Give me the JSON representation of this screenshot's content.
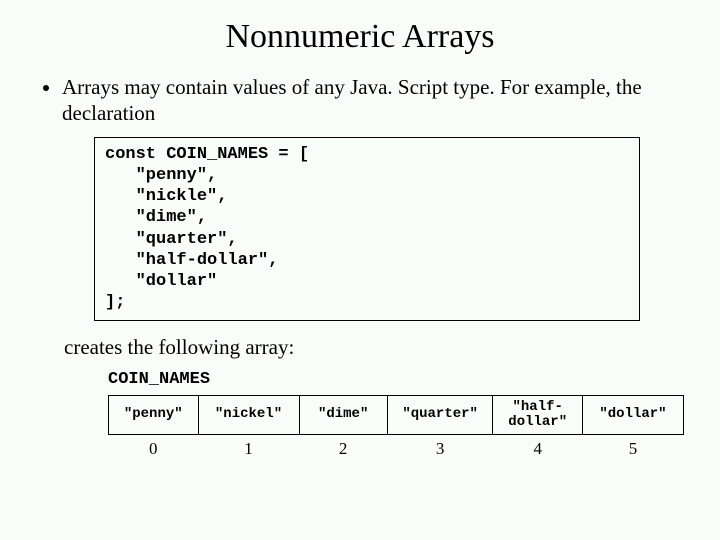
{
  "title": "Nonnumeric Arrays",
  "bullet1": "Arrays may contain values of any Java. Script type.  For example, the declaration",
  "code": "const COIN_NAMES = [\n   \"penny\",\n   \"nickle\",\n   \"dime\",\n   \"quarter\",\n   \"half-dollar\",\n   \"dollar\"\n];",
  "followup": "creates the following array:",
  "arrayLabel": "COIN_NAMES",
  "cells": {
    "c0": "\"penny\"",
    "c1": "\"nickel\"",
    "c2": "\"dime\"",
    "c3": "\"quarter\"",
    "c4": "\"half-\ndollar\"",
    "c5": "\"dollar\""
  },
  "indices": {
    "i0": "0",
    "i1": "1",
    "i2": "2",
    "i3": "3",
    "i4": "4",
    "i5": "5"
  }
}
